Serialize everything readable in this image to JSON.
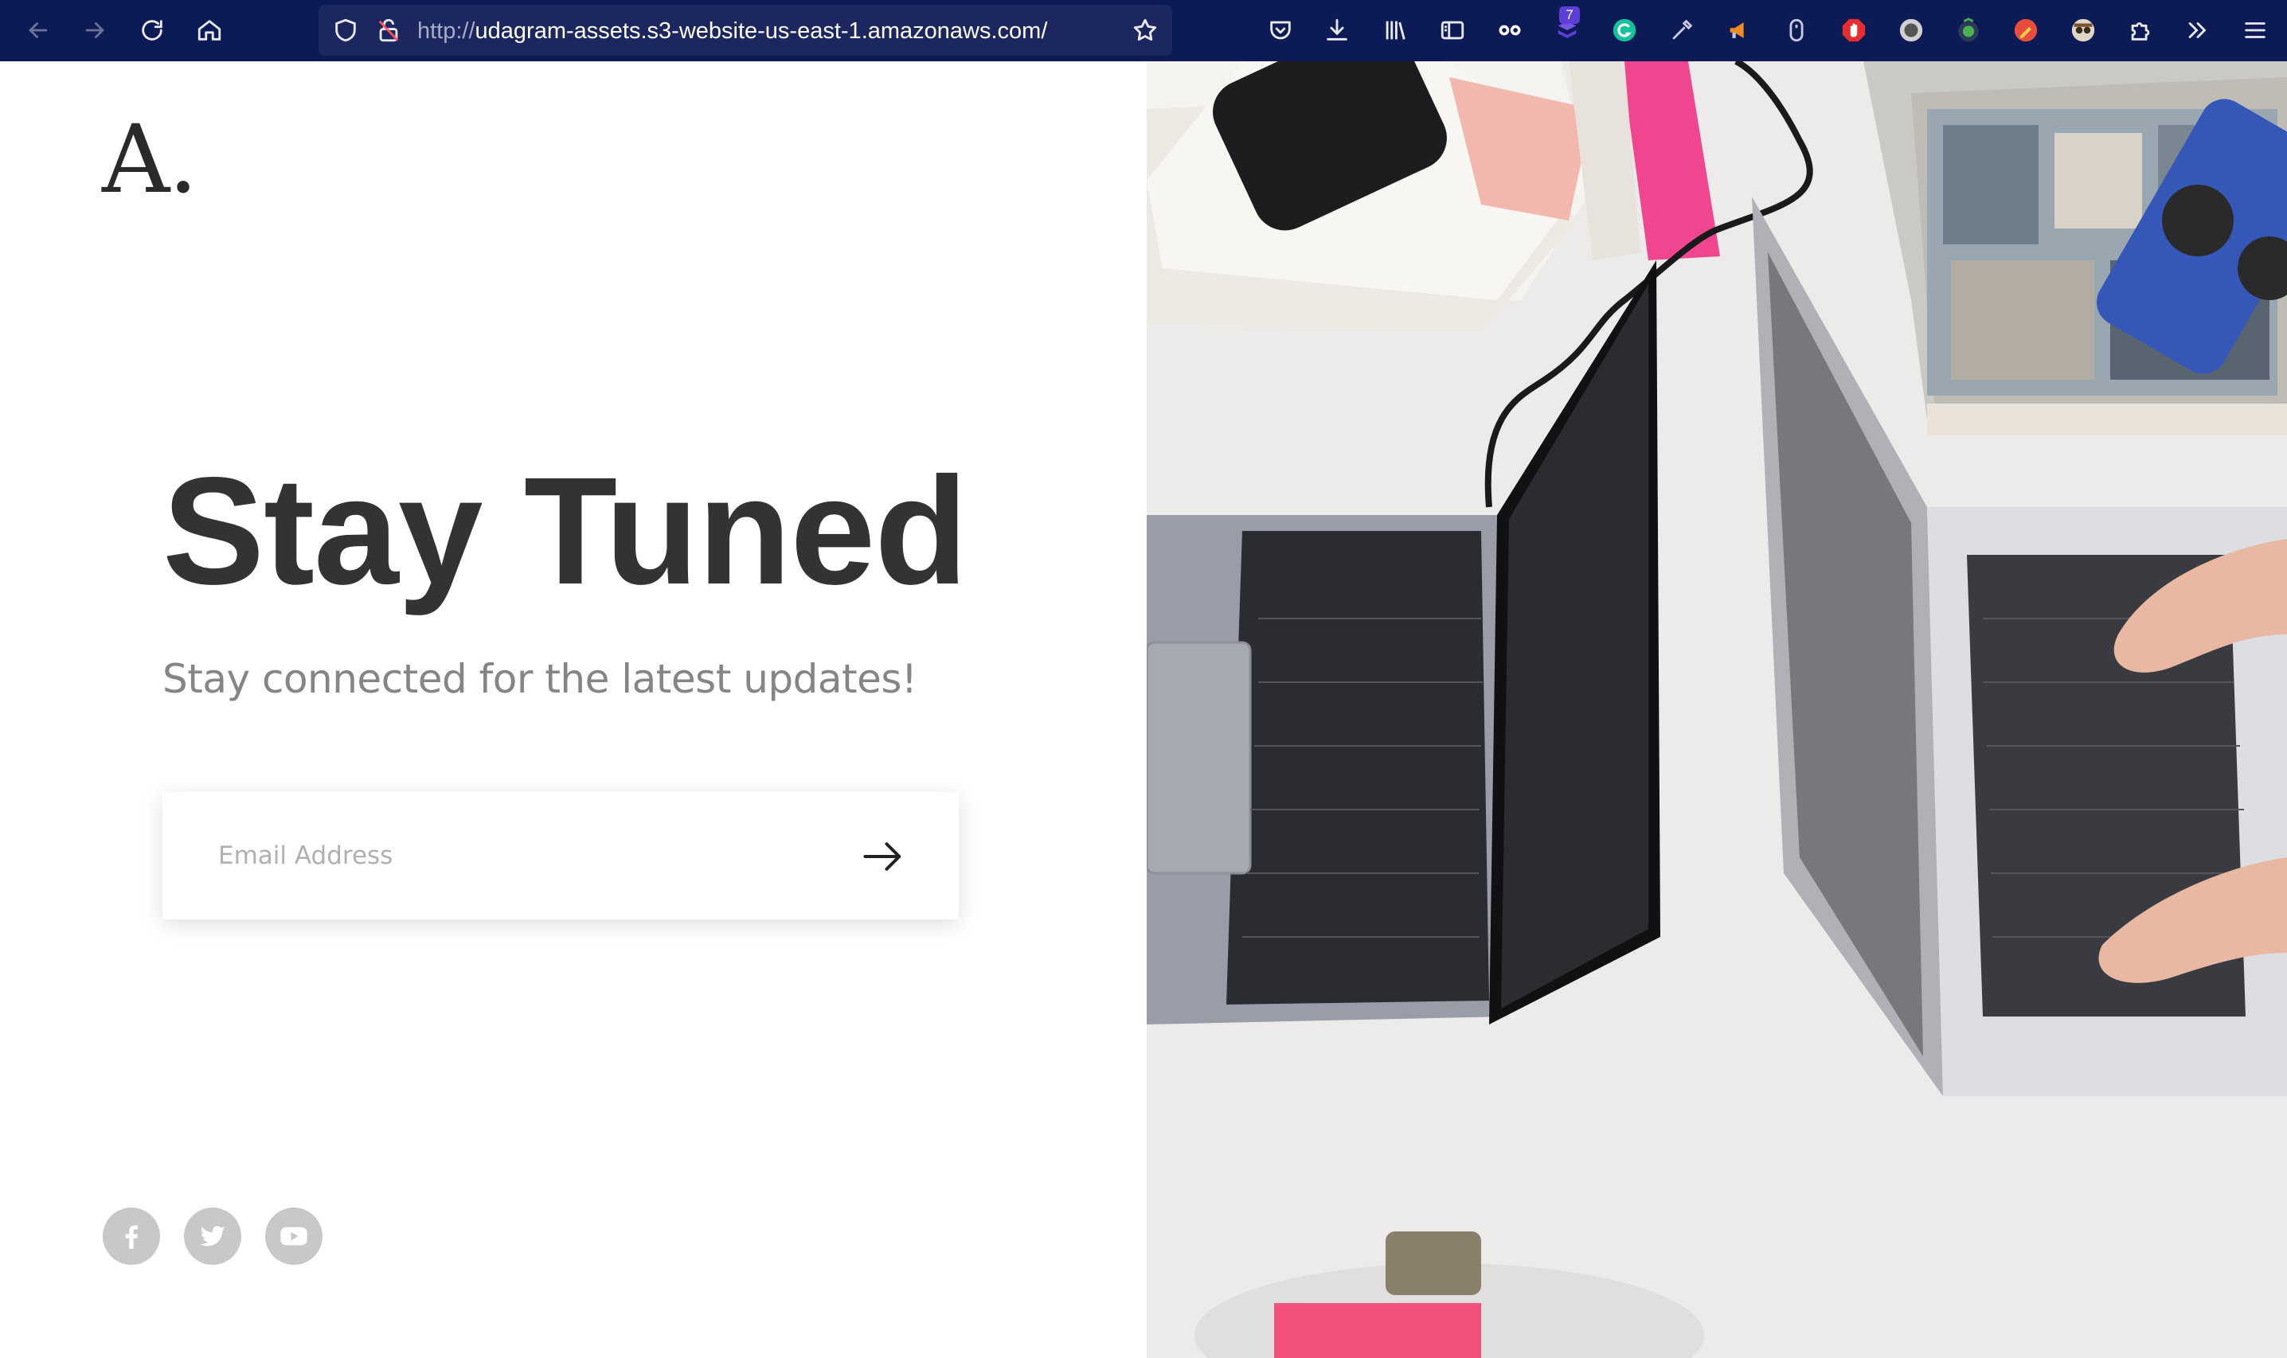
{
  "browser": {
    "url_scheme": "http://",
    "url_host": "udagram-assets.s3-website-us-east-1.amazonaws.com/",
    "extension_badge": "7",
    "icons": [
      "back-icon",
      "forward-icon",
      "reload-icon",
      "home-icon",
      "shield-icon",
      "insecure-lock-icon",
      "bookmark-star-icon",
      "pocket-icon",
      "download-icon",
      "library-icon",
      "sidebar-icon",
      "glasses-extension-icon",
      "grammarly-icon",
      "eyedropper-icon",
      "megaphone-icon",
      "mouse-icon",
      "adblock-icon",
      "record-icon",
      "vpn-icon",
      "color-picker-icon",
      "spy-icon",
      "extensions-puzzle-icon",
      "overflow-chevrons-icon",
      "menu-hamburger-icon"
    ]
  },
  "page": {
    "logo": "A.",
    "headline": "Stay Tuned",
    "subheadline": "Stay connected for the latest updates!",
    "email_placeholder": "Email Address",
    "social": [
      "facebook-icon",
      "twitter-icon",
      "youtube-icon"
    ]
  },
  "colors": {
    "toolbar_bg": "#0c1a56",
    "headline": "#333333",
    "subheadline": "#858585",
    "social_icon_bg": "#c8c8c8"
  }
}
